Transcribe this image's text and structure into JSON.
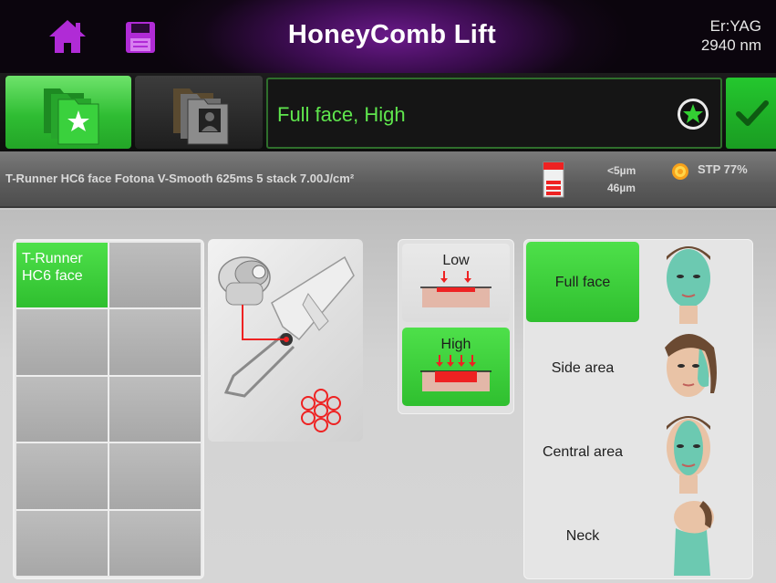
{
  "header": {
    "title": "HoneyComb Lift",
    "laser_line1": "Er:YAG",
    "laser_line2": "2940 nm"
  },
  "program": {
    "name": "Full face, High"
  },
  "info": {
    "params": "T-Runner HC6 face  Fotona V-Smooth  625ms  5 stack  7.00J/cm²",
    "depth1": "<5µm",
    "depth2": "46µm",
    "stp": "STP 77%"
  },
  "handpiece_grid": {
    "selected_label": "T-Runner HC6 face"
  },
  "intensity": {
    "low": "Low",
    "high": "High",
    "selected": "High"
  },
  "areas": {
    "full_face": "Full face",
    "side_area": "Side area",
    "central_area": "Central area",
    "neck": "Neck",
    "selected": "Full face"
  },
  "colors": {
    "accent_green": "#2fbf2f",
    "program_text": "#5fe64d",
    "header_purple": "#6a1a8a",
    "icon_purple": "#b02bd6"
  }
}
